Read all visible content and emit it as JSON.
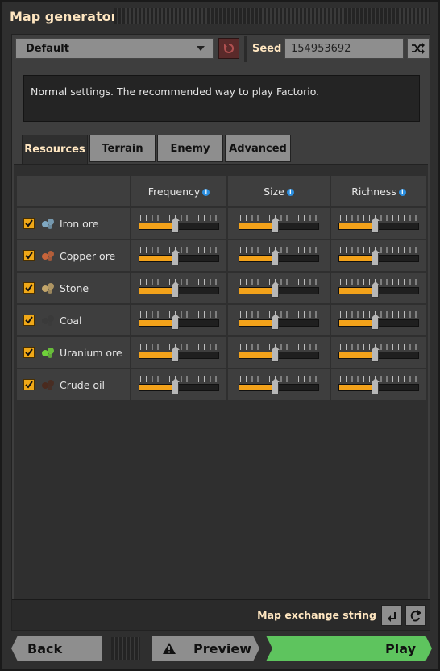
{
  "window": {
    "title": "Map generator"
  },
  "preset": {
    "selected": "Default"
  },
  "seed": {
    "label": "Seed",
    "value": "154953692"
  },
  "description": "Normal settings. The recommended way to play Factorio.",
  "tabs": [
    {
      "label": "Resources",
      "active": true
    },
    {
      "label": "Terrain",
      "active": false
    },
    {
      "label": "Enemy",
      "active": false
    },
    {
      "label": "Advanced",
      "active": false
    }
  ],
  "columns": {
    "frequency": "Frequency",
    "size": "Size",
    "richness": "Richness"
  },
  "resources": [
    {
      "name": "Iron ore",
      "icon": "iron-ore-icon",
      "color": "#7fa8c2",
      "enabled": true,
      "frequency": 0.45,
      "size": 0.45,
      "richness": 0.45
    },
    {
      "name": "Copper ore",
      "icon": "copper-ore-icon",
      "color": "#c8643a",
      "enabled": true,
      "frequency": 0.45,
      "size": 0.45,
      "richness": 0.45
    },
    {
      "name": "Stone",
      "icon": "stone-icon",
      "color": "#c2a56a",
      "enabled": true,
      "frequency": 0.45,
      "size": 0.45,
      "richness": 0.45
    },
    {
      "name": "Coal",
      "icon": "coal-icon",
      "color": "#3a3a3a",
      "enabled": true,
      "frequency": 0.45,
      "size": 0.45,
      "richness": 0.45
    },
    {
      "name": "Uranium ore",
      "icon": "uranium-ore-icon",
      "color": "#6fd23a",
      "enabled": true,
      "frequency": 0.45,
      "size": 0.45,
      "richness": 0.45
    },
    {
      "name": "Crude oil",
      "icon": "crude-oil-icon",
      "color": "#4a2a1e",
      "enabled": true,
      "frequency": 0.45,
      "size": 0.45,
      "richness": 0.45
    }
  ],
  "map_exchange": {
    "label": "Map exchange string"
  },
  "footer": {
    "back": "Back",
    "preview": "Preview",
    "play": "Play"
  },
  "colors": {
    "accent": "#f3a21a",
    "play": "#5ec45e",
    "reset": "#5a2a2a"
  }
}
